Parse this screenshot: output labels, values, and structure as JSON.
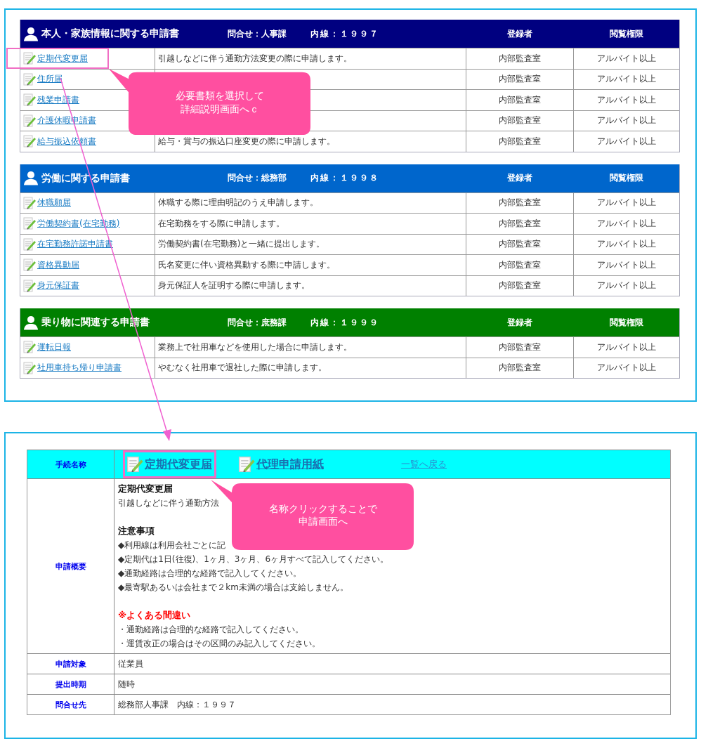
{
  "list_panel": {
    "sections": [
      {
        "title": "本人・家族情報に関する申請書",
        "color": "#000080",
        "contact": "問合せ：人事課",
        "extension": "内線：１９９７",
        "col_registrant": "登録者",
        "col_permission": "閲覧権限",
        "rows": [
          {
            "name": "定期代変更届",
            "description": "引越しなどに伴う通勤方法変更の際に申請します。",
            "registrant": "内部監査室",
            "permission": "アルバイト以上",
            "highlighted": true
          },
          {
            "name": "住所届",
            "registrant": "内部監査室",
            "permission": "アルバイト以上",
            "highlighted": false
          },
          {
            "name": "残業申請書",
            "registrant": "内部監査室",
            "permission": "アルバイト以上",
            "highlighted": false
          },
          {
            "name": "介護休暇申請書",
            "registrant": "内部監査室",
            "permission": "アルバイト以上",
            "highlighted": false
          },
          {
            "name": "給与振込依頼書",
            "description": "給与・賞与の振込口座変更の際に申請します。",
            "registrant": "内部監査室",
            "permission": "アルバイト以上",
            "highlighted": false
          }
        ]
      },
      {
        "title": "労働に関する申請書",
        "color": "#0066cc",
        "contact": "問合せ：総務部",
        "extension": "内線：１９９８",
        "col_registrant": "登録者",
        "col_permission": "閲覧権限",
        "rows": [
          {
            "name": "休職願届",
            "description": "休職する際に理由明記のうえ申請します。",
            "registrant": "内部監査室",
            "permission": "アルバイト以上",
            "highlighted": false
          },
          {
            "name": "労働契約書(在宅勤務)",
            "description": "在宅勤務をする際に申請します。",
            "registrant": "内部監査室",
            "permission": "アルバイト以上",
            "highlighted": false
          },
          {
            "name": "在宅勤務許諾申請書",
            "description": "労働契約書(在宅勤務)と一緒に提出します。",
            "registrant": "内部監査室",
            "permission": "アルバイト以上",
            "highlighted": false
          },
          {
            "name": "資格異動届",
            "description": "氏名変更に伴い資格異動する際に申請します。",
            "registrant": "内部監査室",
            "permission": "アルバイト以上",
            "highlighted": false
          },
          {
            "name": "身元保証書",
            "description": "身元保証人を証明する際に申請します。",
            "registrant": "内部監査室",
            "permission": "アルバイト以上",
            "highlighted": false
          }
        ]
      },
      {
        "title": "乗り物に関連する申請書",
        "color": "#008000",
        "contact": "問合せ：庶務課",
        "extension": "内線：１９９９",
        "col_registrant": "登録者",
        "col_permission": "閲覧権限",
        "rows": [
          {
            "name": "運転日報",
            "description": "業務上で社用車などを使用した場合に申請します。",
            "registrant": "内部監査室",
            "permission": "アルバイト以上",
            "highlighted": false
          },
          {
            "name": "社用車持ち帰り申請書",
            "description": "やむなく社用車で退社した際に申請します。",
            "registrant": "内部監査室",
            "permission": "アルバイト以上",
            "highlighted": false
          }
        ]
      }
    ],
    "callout": [
      "必要書類を選択して",
      "詳細説明画面へｃ"
    ]
  },
  "detail_panel": {
    "header": {
      "label": "手続名称",
      "links": [
        {
          "text": "定期代変更届",
          "kind": "form",
          "highlighted": true
        },
        {
          "text": "代理申請用紙",
          "kind": "form",
          "highlighted": false
        },
        {
          "text": "一覧へ戻る",
          "kind": "back",
          "highlighted": false
        }
      ]
    },
    "rows": [
      {
        "label": "申請概要",
        "lines": [
          {
            "kind": "heading",
            "text": "定期代変更届"
          },
          {
            "kind": "text",
            "text": "引越しなどに伴う通勤方法"
          },
          {
            "kind": "spacer"
          },
          {
            "kind": "heading",
            "text": "注意事項"
          },
          {
            "kind": "text",
            "text": "◆利用線は利用会社ごとに記"
          },
          {
            "kind": "text",
            "text": "◆定期代は1日(往復)、1ヶ月、3ヶ月、6ヶ月すべて記入してください。"
          },
          {
            "kind": "text",
            "text": "◆通勤経路は合理的な経路で記入してください。"
          },
          {
            "kind": "text",
            "text": "◆最寄駅あるいは会社まで２km未満の場合は支給しません。"
          },
          {
            "kind": "spacer"
          },
          {
            "kind": "warning",
            "text": "※よくある間違い"
          },
          {
            "kind": "text",
            "text": "・通勤経路は合理的な経路で記入してください。"
          },
          {
            "kind": "text",
            "text": "・運賃改正の場合はその区間のみ記入してください。"
          }
        ]
      },
      {
        "label": "申請対象",
        "lines": [
          {
            "kind": "text",
            "text": "従業員"
          }
        ]
      },
      {
        "label": "提出時期",
        "lines": [
          {
            "kind": "text",
            "text": "随時"
          }
        ]
      },
      {
        "label": "問合せ先",
        "lines": [
          {
            "kind": "text",
            "text": "総務部人事課　内線：１９９７"
          }
        ]
      }
    ],
    "callout": [
      "名称クリックすることで",
      "申請画面へ"
    ]
  }
}
